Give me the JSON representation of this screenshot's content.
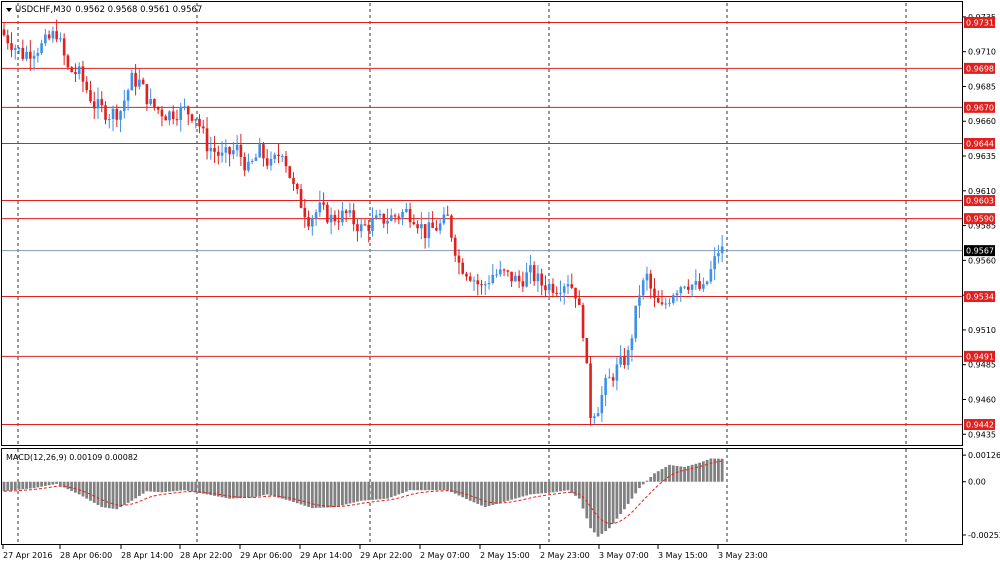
{
  "window": {
    "symbol_title": "USDCHF,M30",
    "ohlc": "0.9562 0.9568 0.9561 0.9567",
    "macd_title": "MACD(12,26,9) 0.00109 0.00082"
  },
  "colors": {
    "bull": "#3d8fe8",
    "bear": "#e0201e",
    "level_line": "#e0201e",
    "level_badge": "#e0201e",
    "current_line": "#8497b0",
    "current_badge": "#000000",
    "macd_hist": "#808080",
    "macd_signal": "#e0201e",
    "grid": "#000000"
  },
  "chart_data": {
    "type": "candlestick",
    "y_ticks": [
      "0.9735",
      "0.9710",
      "0.9685",
      "0.9660",
      "0.9635",
      "0.9610",
      "0.9585",
      "0.9560",
      "0.9535",
      "0.9510",
      "0.9485",
      "0.9460",
      "0.9435"
    ],
    "ylim": [
      0.9428,
      0.9745
    ],
    "x_ticks": [
      "27 Apr 2016",
      "28 Apr 06:00",
      "28 Apr 14:00",
      "28 Apr 22:00",
      "29 Apr 06:00",
      "29 Apr 14:00",
      "29 Apr 22:00",
      "2 May 07:00",
      "2 May 15:00",
      "2 May 23:00",
      "3 May 07:00",
      "3 May 15:00",
      "3 May 23:00"
    ],
    "levels": [
      "0.9731",
      "0.9698",
      "0.9670",
      "0.9644",
      "0.9603",
      "0.9590",
      "0.9534",
      "0.9491",
      "0.9442"
    ],
    "current_price": "0.9567",
    "anchors": [
      [
        0,
        0.9722
      ],
      [
        5,
        0.9708
      ],
      [
        10,
        0.9714
      ],
      [
        14,
        0.9724
      ],
      [
        17,
        0.9697
      ],
      [
        20,
        0.9694
      ],
      [
        24,
        0.9672
      ],
      [
        28,
        0.9665
      ],
      [
        31,
        0.9668
      ],
      [
        34,
        0.969
      ],
      [
        36,
        0.9688
      ],
      [
        39,
        0.9672
      ],
      [
        43,
        0.9665
      ],
      [
        48,
        0.9668
      ],
      [
        51,
        0.9664
      ],
      [
        54,
        0.9643
      ],
      [
        58,
        0.9634
      ],
      [
        62,
        0.964
      ],
      [
        65,
        0.9625
      ],
      [
        68,
        0.9638
      ],
      [
        71,
        0.9628
      ],
      [
        74,
        0.964
      ],
      [
        77,
        0.9612
      ],
      [
        81,
        0.959
      ],
      [
        84,
        0.9597
      ],
      [
        87,
        0.959
      ],
      [
        91,
        0.9593
      ],
      [
        95,
        0.9583
      ],
      [
        99,
        0.9588
      ],
      [
        103,
        0.9591
      ],
      [
        107,
        0.9595
      ],
      [
        109,
        0.9592
      ],
      [
        112,
        0.958
      ],
      [
        116,
        0.9585
      ],
      [
        118,
        0.959
      ],
      [
        121,
        0.9558
      ],
      [
        124,
        0.955
      ],
      [
        127,
        0.954
      ],
      [
        130,
        0.955
      ],
      [
        133,
        0.955
      ],
      [
        137,
        0.9545
      ],
      [
        140,
        0.9551
      ],
      [
        143,
        0.9543
      ],
      [
        147,
        0.9541
      ],
      [
        150,
        0.9546
      ],
      [
        152,
        0.9537
      ],
      [
        154,
        0.951
      ],
      [
        156,
        0.945
      ],
      [
        158,
        0.9455
      ],
      [
        160,
        0.947
      ],
      [
        163,
        0.9482
      ],
      [
        166,
        0.9492
      ],
      [
        169,
        0.9537
      ],
      [
        171,
        0.9548
      ],
      [
        173,
        0.953
      ],
      [
        175,
        0.9525
      ],
      [
        178,
        0.9538
      ],
      [
        181,
        0.9545
      ],
      [
        184,
        0.9541
      ],
      [
        186,
        0.9538
      ],
      [
        188,
        0.9552
      ],
      [
        190,
        0.9567
      ],
      [
        191,
        0.9567
      ]
    ],
    "macd_ticks": [
      "0.00126",
      "0.00",
      "-0.00252"
    ],
    "macd_ylim": [
      -0.0029,
      0.00155
    ],
    "macd_anchors": [
      [
        0,
        -0.00045
      ],
      [
        8,
        -0.0003
      ],
      [
        14,
        -0.0001
      ],
      [
        20,
        -0.0006
      ],
      [
        26,
        -0.0012
      ],
      [
        30,
        -0.0013
      ],
      [
        34,
        -0.0009
      ],
      [
        38,
        -0.00045
      ],
      [
        42,
        -0.0005
      ],
      [
        48,
        -0.0004
      ],
      [
        54,
        -0.0006
      ],
      [
        60,
        -0.0008
      ],
      [
        66,
        -0.00075
      ],
      [
        70,
        -0.0006
      ],
      [
        76,
        -0.0009
      ],
      [
        82,
        -0.00125
      ],
      [
        88,
        -0.0012
      ],
      [
        95,
        -0.0009
      ],
      [
        102,
        -0.0008
      ],
      [
        108,
        -0.0004
      ],
      [
        112,
        -0.0004
      ],
      [
        118,
        -0.0004
      ],
      [
        124,
        -0.0009
      ],
      [
        128,
        -0.0012
      ],
      [
        134,
        -0.0009
      ],
      [
        140,
        -0.0006
      ],
      [
        146,
        -0.0005
      ],
      [
        150,
        -0.0004
      ],
      [
        153,
        -0.0008
      ],
      [
        156,
        -0.0022
      ],
      [
        158,
        -0.0026
      ],
      [
        161,
        -0.0022
      ],
      [
        165,
        -0.0013
      ],
      [
        169,
        -0.0003
      ],
      [
        173,
        0.0004
      ],
      [
        177,
        0.0008
      ],
      [
        181,
        0.0007
      ],
      [
        185,
        0.0009
      ],
      [
        188,
        0.0011
      ],
      [
        191,
        0.00109
      ]
    ]
  }
}
